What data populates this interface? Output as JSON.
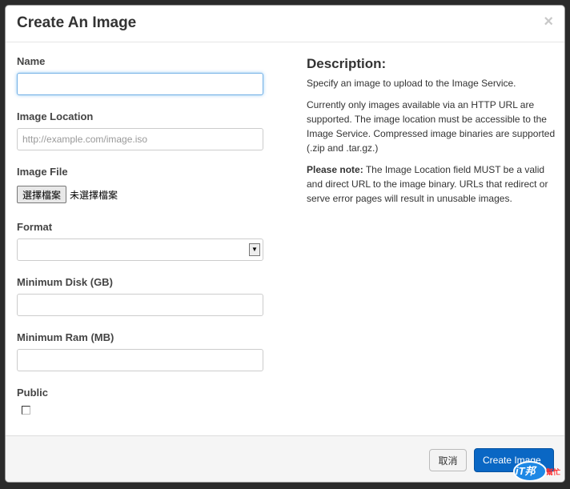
{
  "dialog": {
    "title": "Create An Image",
    "close_glyph": "×"
  },
  "form": {
    "name_label": "Name",
    "name_value": "",
    "location_label": "Image Location",
    "location_placeholder": "http://example.com/image.iso",
    "file_label": "Image File",
    "file_button": "選擇檔案",
    "file_status": "未選擇檔案",
    "format_label": "Format",
    "format_value": "",
    "min_disk_label": "Minimum Disk (GB)",
    "min_disk_value": "",
    "min_ram_label": "Minimum Ram (MB)",
    "min_ram_value": "",
    "public_label": "Public",
    "public_checked": false
  },
  "description": {
    "heading": "Description:",
    "p1": "Specify an image to upload to the Image Service.",
    "p2": "Currently only images available via an HTTP URL are supported. The image location must be accessible to the Image Service. Compressed image binaries are supported (.zip and .tar.gz.)",
    "note_label": "Please note:",
    "note_text": " The Image Location field MUST be a valid and direct URL to the image binary. URLs that redirect or serve error pages will result in unusable images."
  },
  "footer": {
    "cancel_label": "取消",
    "submit_label": "Create Image"
  },
  "watermark": {
    "text": "iT邦",
    "text2": "幫忙"
  },
  "colors": {
    "primary": "#0a67c4",
    "focus": "#74b1e6"
  }
}
